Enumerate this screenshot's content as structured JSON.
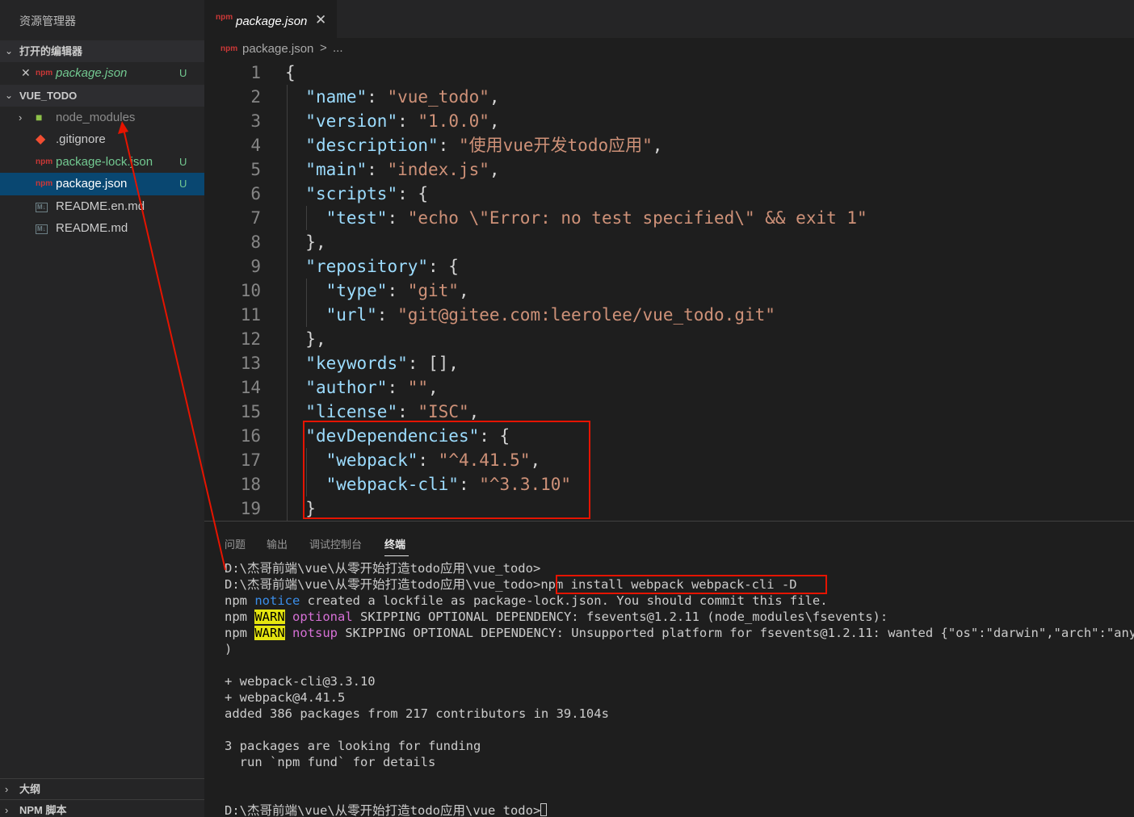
{
  "sidebar": {
    "title": "资源管理器",
    "open_editors": {
      "label": "打开的编辑器",
      "files": [
        {
          "name": "package.json",
          "badge": "U"
        }
      ]
    },
    "project": {
      "label": "VUE_TODO",
      "items": [
        {
          "name": "node_modules",
          "badge": ""
        },
        {
          "name": ".gitignore",
          "badge": ""
        },
        {
          "name": "package-lock.json",
          "badge": "U"
        },
        {
          "name": "package.json",
          "badge": "U"
        },
        {
          "name": "README.en.md",
          "badge": ""
        },
        {
          "name": "README.md",
          "badge": ""
        }
      ]
    },
    "outline_label": "大纲",
    "npm_scripts_label": "NPM 脚本"
  },
  "tab": {
    "label": "package.json",
    "close": "✕"
  },
  "breadcrumb": {
    "file": "package.json",
    "sep": ">",
    "more": "..."
  },
  "editor": {
    "line_numbers": [
      "1",
      "2",
      "3",
      "4",
      "5",
      "6",
      "7",
      "8",
      "9",
      "10",
      "11",
      "12",
      "13",
      "14",
      "15",
      "16",
      "17",
      "18",
      "19"
    ],
    "values": {
      "name": "\"vue_todo\"",
      "version": "\"1.0.0\"",
      "description": "\"使用vue开发todo应用\"",
      "main": "\"index.js\"",
      "test": "\"echo \\\"Error: no test specified\\\" && exit 1\"",
      "type": "\"git\"",
      "url": "\"git@gitee.com:leerolee/vue_todo.git\"",
      "author": "\"\"",
      "license": "\"ISC\"",
      "webpack": "\"^4.41.5\"",
      "webpack_cli": "\"^3.3.10\""
    },
    "keys": {
      "name": "\"name\"",
      "version": "\"version\"",
      "description": "\"description\"",
      "main": "\"main\"",
      "scripts": "\"scripts\"",
      "test": "\"test\"",
      "repository": "\"repository\"",
      "type": "\"type\"",
      "url": "\"url\"",
      "keywords": "\"keywords\"",
      "author": "\"author\"",
      "license": "\"license\"",
      "devDependencies": "\"devDependencies\"",
      "webpack": "\"webpack\"",
      "webpack_cli": "\"webpack-cli\""
    }
  },
  "panel": {
    "tabs": [
      "问题",
      "输出",
      "调试控制台",
      "终端"
    ],
    "terminal": {
      "l1": "D:\\杰哥前端\\vue\\从零开始打造todo应用\\vue_todo>",
      "l2_prompt": "D:\\杰哥前端\\vue\\从零开始打造todo应用\\vue_todo>",
      "l2_cmd": "npm install webpack webpack-cli -D",
      "l3_a": "npm ",
      "l3_b": "notice",
      "l3_c": " created a lockfile as package-lock.json. You should commit this file.",
      "l4_a": "npm ",
      "l4_b": "WARN",
      "l4_c": " ",
      "l4_d": "optional",
      "l4_e": " SKIPPING OPTIONAL DEPENDENCY: fsevents@1.2.11 (node_modules\\fsevents):",
      "l5_a": "npm ",
      "l5_b": "WARN",
      "l5_c": " ",
      "l5_d": "notsup",
      "l5_e": " SKIPPING OPTIONAL DEPENDENCY: Unsupported platform for fsevents@1.2.11: wanted {\"os\":\"darwin\",\"arch\":\"any\"} (",
      "l6": ")",
      "l7": "+ webpack-cli@3.3.10",
      "l8": "+ webpack@4.41.5",
      "l9": "added 386 packages from 217 contributors in 39.104s",
      "l10": "3 packages are looking for funding",
      "l11": "  run `npm fund` for details",
      "l12": "D:\\杰哥前端\\vue\\从零开始打造todo应用\\vue_todo>"
    }
  },
  "colors": {
    "highlight_box": "#e51400",
    "json_key": "#9cdcfe",
    "json_string": "#ce9178",
    "selection": "#094771",
    "git_untracked": "#73c991"
  }
}
